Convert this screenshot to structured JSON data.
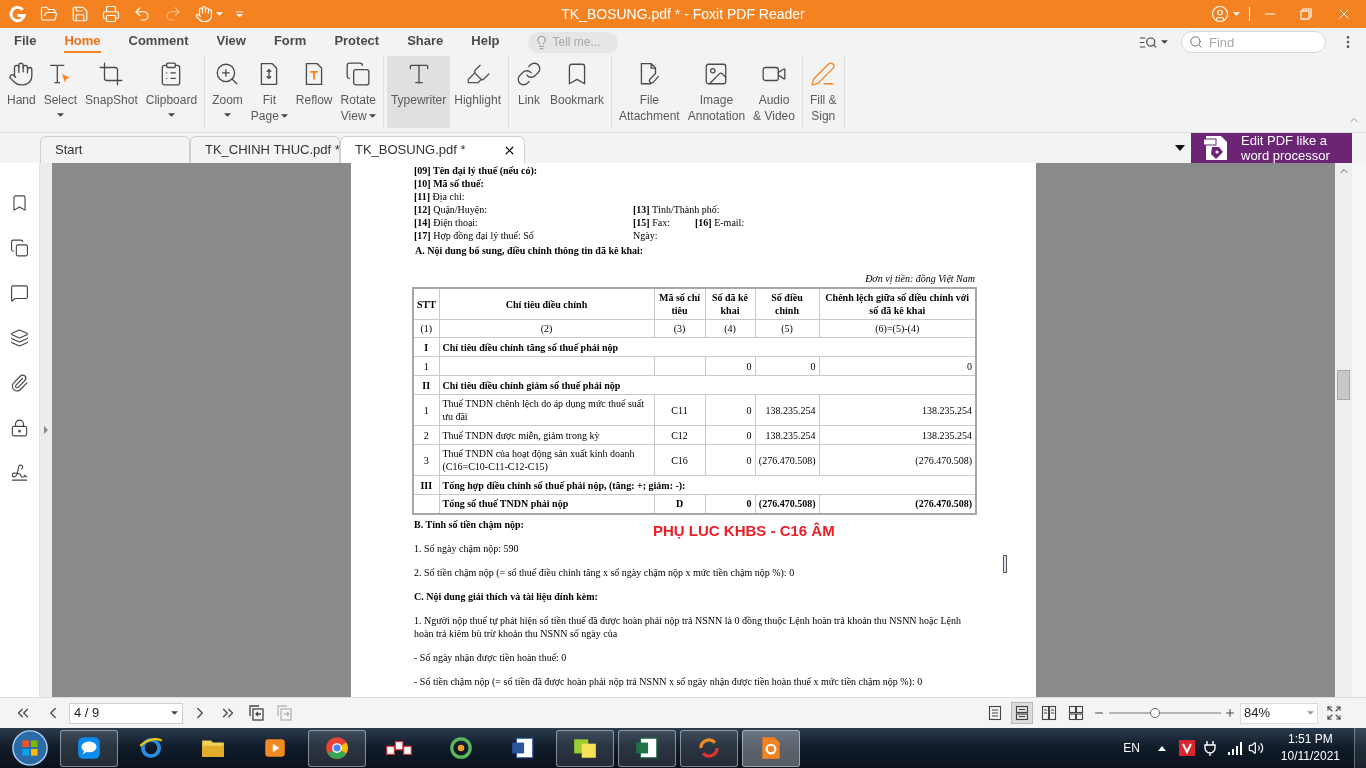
{
  "window": {
    "title": "TK_BOSUNG.pdf * - Foxit PDF Reader"
  },
  "quick_access": [
    {
      "disabled": false
    },
    {
      "disabled": false
    },
    {
      "disabled": false
    },
    {
      "disabled": false
    },
    {
      "disabled": true
    },
    {
      "disabled": false
    }
  ],
  "menu_tabs": [
    {
      "label": "File",
      "selected": false
    },
    {
      "label": "Home",
      "selected": true
    },
    {
      "label": "Comment",
      "selected": false
    },
    {
      "label": "View",
      "selected": false
    },
    {
      "label": "Form",
      "selected": false
    },
    {
      "label": "Protect",
      "selected": false
    },
    {
      "label": "Share",
      "selected": false
    },
    {
      "label": "Help",
      "selected": false
    }
  ],
  "tell_me": {
    "placeholder": "Tell me..."
  },
  "find": {
    "placeholder": "Find"
  },
  "ribbon_groups": [
    {
      "tools": [
        {
          "lines": [
            "Hand"
          ],
          "dropdown": false,
          "selected": false
        },
        {
          "lines": [
            "Select"
          ],
          "dropdown": true,
          "selected": false
        },
        {
          "lines": [
            "SnapShot"
          ],
          "dropdown": false,
          "selected": false
        },
        {
          "lines": [
            "Clipboard"
          ],
          "dropdown": true,
          "selected": false
        }
      ]
    },
    {
      "tools": [
        {
          "lines": [
            "Zoom"
          ],
          "dropdown": true,
          "selected": false
        },
        {
          "lines": [
            "Fit",
            "Page"
          ],
          "dropdown": true,
          "selected": false
        },
        {
          "lines": [
            "Reflow"
          ],
          "dropdown": false,
          "selected": false
        },
        {
          "lines": [
            "Rotate",
            "View"
          ],
          "dropdown": true,
          "selected": false
        }
      ]
    },
    {
      "tools": [
        {
          "lines": [
            "Typewriter"
          ],
          "dropdown": false,
          "selected": true
        },
        {
          "lines": [
            "Highlight"
          ],
          "dropdown": false,
          "selected": false
        }
      ]
    },
    {
      "tools": [
        {
          "lines": [
            "Link"
          ],
          "dropdown": false,
          "selected": false
        },
        {
          "lines": [
            "Bookmark"
          ],
          "dropdown": false,
          "selected": false
        }
      ]
    },
    {
      "tools": [
        {
          "lines": [
            "File",
            "Attachment"
          ],
          "dropdown": false,
          "selected": false
        },
        {
          "lines": [
            "Image",
            "Annotation"
          ],
          "dropdown": false,
          "selected": false
        },
        {
          "lines": [
            "Audio",
            "& Video"
          ],
          "dropdown": false,
          "selected": false
        }
      ]
    },
    {
      "tools": [
        {
          "lines": [
            "Fill &",
            "Sign"
          ],
          "dropdown": false,
          "selected": false
        }
      ]
    }
  ],
  "doc_tabs": [
    {
      "label": "Start",
      "selected": false
    },
    {
      "label": "TK_CHINH THUC.pdf *",
      "selected": false
    },
    {
      "label": "TK_BOSUNG.pdf *",
      "selected": true
    }
  ],
  "promo": {
    "lines": [
      "Edit PDF like a",
      "word processor"
    ]
  },
  "document": {
    "info_lines": [
      {
        "bold": true,
        "cells": [
          "[09] Tên đại lý thuế (nếu có):"
        ]
      },
      {
        "bold": true,
        "cells": [
          "[10] Mã số thuế:"
        ]
      },
      {
        "bold": false,
        "cells": [
          "**[11]** Địa chỉ:"
        ]
      },
      {
        "bold": false,
        "cells": [
          "**[12]** Quận/Huyện:",
          "**[13]** Tỉnh/Thành phố:"
        ]
      },
      {
        "bold": false,
        "cells": [
          "**[14]** Điện thoại:",
          "**[15]** Fax:",
          "**[16]** E-mail:"
        ]
      },
      {
        "bold": false,
        "cells": [
          "**[17]** Hợp đồng đại lý thuế: Số",
          "Ngày:"
        ]
      }
    ],
    "heading_a": "A. Nội dung bổ sung, điều chỉnh thông tin đã kê khai:",
    "unit_note": "Đơn vị tiền: đồng Việt Nam",
    "table": {
      "columns": [
        "STT",
        "Chỉ tiêu điều chỉnh",
        "Mã số chỉ tiêu",
        "Số đã kê khai",
        "Số điều chỉnh",
        "Chênh lệch giữa số điều chỉnh với số đã kê khai"
      ],
      "index_row": [
        "(1)",
        "(2)",
        "(3)",
        "(4)",
        "(5)",
        "(6)=(5)-(4)"
      ],
      "rows": [
        {
          "kind": "section",
          "stt": "I",
          "item": "Chỉ tiêu điều chỉnh tăng số thuế phải nộp"
        },
        {
          "kind": "item",
          "stt": "1",
          "declared": "0",
          "adjusted": "0",
          "difference": "0"
        },
        {
          "kind": "section",
          "stt": "II",
          "item": "Chỉ tiêu điều chỉnh giảm số thuế phải nộp"
        },
        {
          "kind": "item",
          "stt": "1",
          "item": "Thuế TNDN chênh lệch do áp dụng mức thuế suất ưu đãi",
          "code": "C11",
          "declared": "0",
          "adjusted": "138.235.254",
          "difference": "138.235.254"
        },
        {
          "kind": "item",
          "stt": "2",
          "item": "Thuế TNDN được miễn, giảm trong kỳ",
          "code": "C12",
          "declared": "0",
          "adjusted": "138.235.254",
          "difference": "138.235.254"
        },
        {
          "kind": "item",
          "stt": "3",
          "item": "Thuế TNDN của hoạt động sản xuất kinh doanh (C16=C10-C11-C12-C15)",
          "code": "C16",
          "declared": "0",
          "adjusted": "(276.470.508)",
          "difference": "(276.470.508)"
        },
        {
          "kind": "section",
          "stt": "III",
          "item": "Tổng hợp điều chỉnh số thuế phải nộp, (tăng: +; giảm: -):"
        },
        {
          "kind": "total",
          "item": "Tổng số thuế TNDN phải nộp",
          "code": "D",
          "declared": "0",
          "adjusted": "(276.470.508)",
          "difference": "(276.470.508)"
        }
      ]
    },
    "body": [
      {
        "bold": true,
        "text": "B. Tính số tiền chậm nộp:"
      },
      {
        "bold": false,
        "text": "1. Số ngày chậm nộp: 590"
      },
      {
        "bold": false,
        "text": "2. Số tiền chậm nộp (= số thuế điều chỉnh tăng x số ngày chậm nộp x mức tiền chậm nộp %): 0"
      },
      {
        "bold": true,
        "text": "C. Nội dung giải thích và tài liệu đính kèm:"
      },
      {
        "bold": false,
        "text": "1. Người nộp thuế tự phát hiện số tiền thuế đã được hoàn phải nộp trả NSNN là 0 đồng thuộc Lệnh hoàn trả khoản thu NSNN hoặc Lệnh hoàn trả kiêm bù trừ khoản thu NSNN số ngày của"
      },
      {
        "bold": false,
        "text": "- Số ngày nhận được tiền hoàn thuế: 0"
      },
      {
        "bold": false,
        "text": "- Số tiền chậm nộp (= số tiền đã được hoàn phải nộp trả NSNN x số ngày nhận được tiền hoàn thuế x mức tiền chậm nộp %): 0"
      }
    ],
    "stamp": "PHỤ LUC KHBS - C16 ÂM"
  },
  "status_bar": {
    "page": "4 / 9",
    "view_modes": [
      {
        "selected": false
      },
      {
        "selected": true
      },
      {
        "selected": false
      },
      {
        "selected": false
      }
    ],
    "zoom": {
      "level": 0.41,
      "value": "84%"
    }
  },
  "taskbar": {
    "apps": [
      {
        "open": true,
        "selected": false
      },
      {
        "open": false,
        "selected": false
      },
      {
        "open": false,
        "selected": false
      },
      {
        "open": false,
        "selected": false
      },
      {
        "open": true,
        "selected": false
      },
      {
        "open": false,
        "selected": false
      },
      {
        "open": false,
        "selected": false
      },
      {
        "open": false,
        "selected": false
      },
      {
        "open": true,
        "selected": false
      },
      {
        "open": true,
        "selected": false
      },
      {
        "open": true,
        "selected": false
      },
      {
        "open": true,
        "selected": true
      }
    ],
    "language": "EN",
    "time": "1:51 PM",
    "date": "10/11/2021"
  }
}
